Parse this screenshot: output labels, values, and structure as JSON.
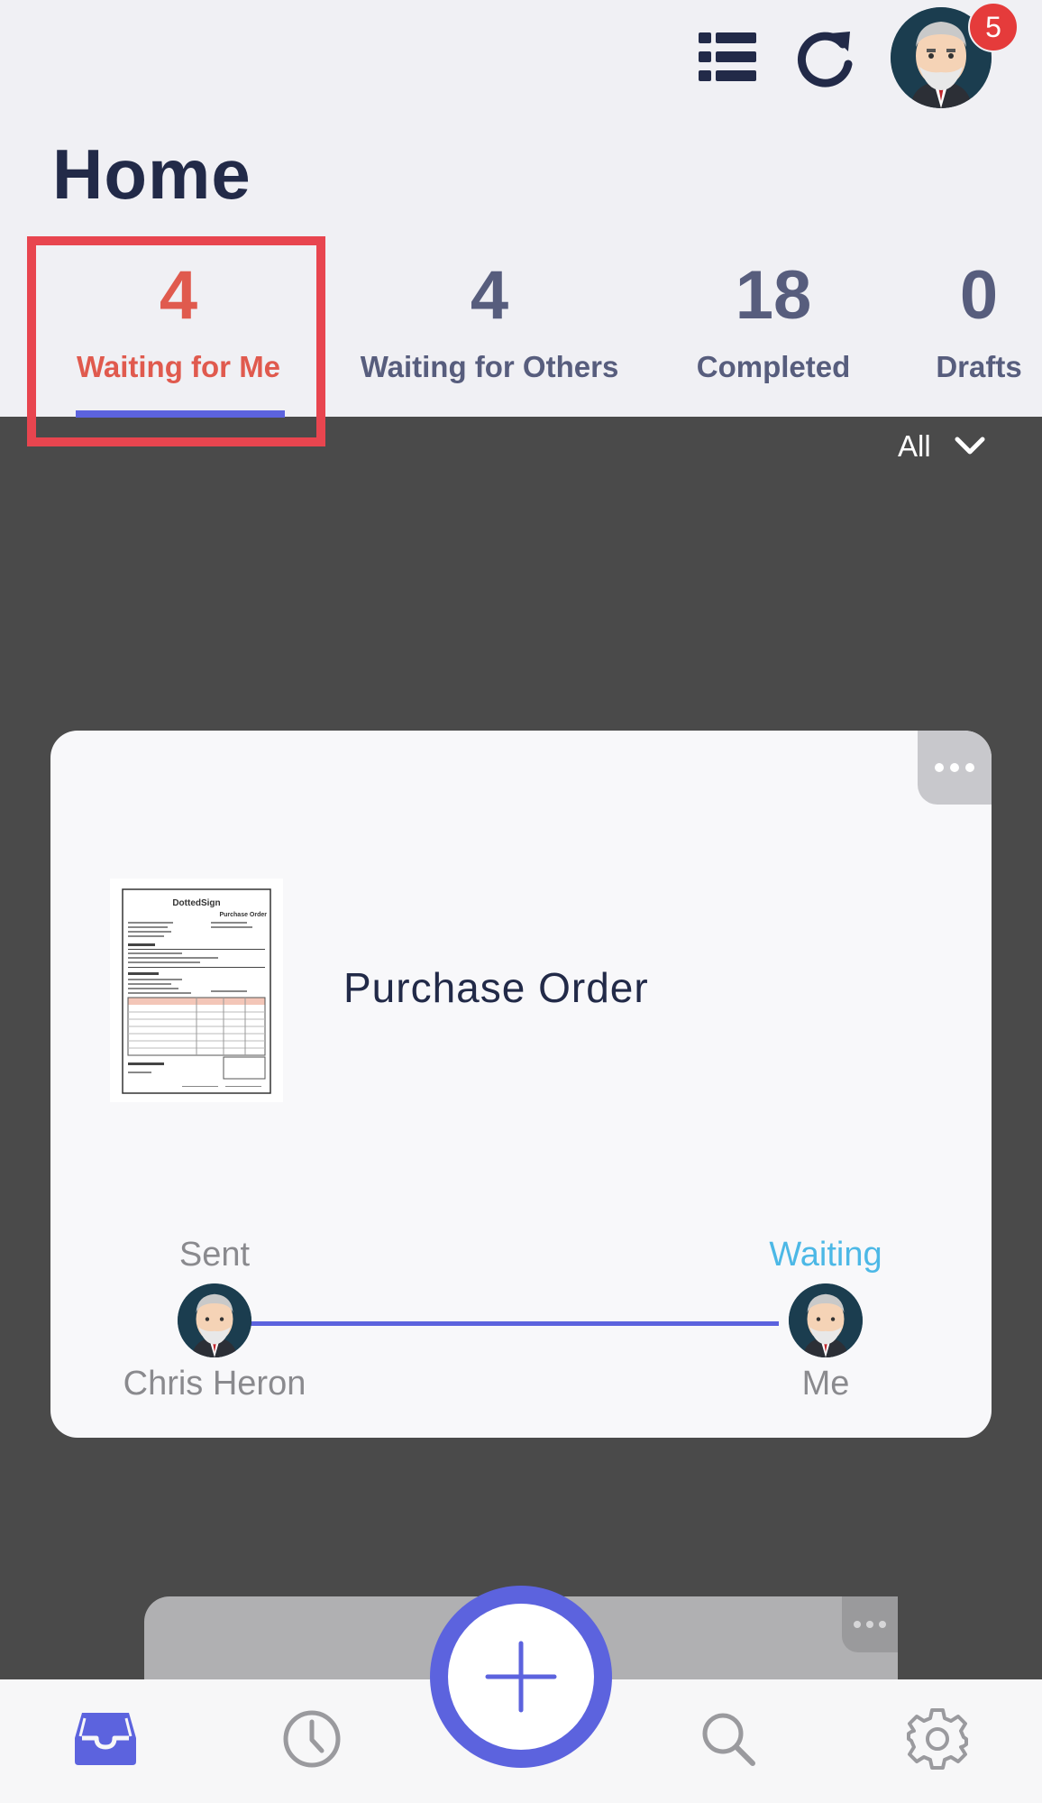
{
  "header": {
    "title": "Home",
    "notification_count": "5"
  },
  "tabs": [
    {
      "count": "4",
      "label": "Waiting for Me",
      "active": true
    },
    {
      "count": "4",
      "label": "Waiting for Others"
    },
    {
      "count": "18",
      "label": "Completed"
    },
    {
      "count": "0",
      "label": "Drafts"
    }
  ],
  "filter": {
    "selected": "All"
  },
  "documents": [
    {
      "title": "Purchase Order",
      "thumbnail_title": "DottedSign",
      "thumbnail_subtitle": "Purchase Order",
      "sender_status": "Sent",
      "sender_name": "Chris Heron",
      "recipient_status": "Waiting",
      "recipient_name": "Me"
    }
  ],
  "colors": {
    "accent": "#5c63de",
    "active_tab": "#e05a4e",
    "waiting": "#4cb8e6",
    "highlight": "#e8454f",
    "title": "#222a48"
  },
  "icons": {
    "list": "list-icon",
    "refresh": "refresh-icon",
    "inbox": "inbox-icon",
    "history": "clock-icon",
    "add": "plus-icon",
    "search": "search-icon",
    "settings": "gear-icon"
  }
}
